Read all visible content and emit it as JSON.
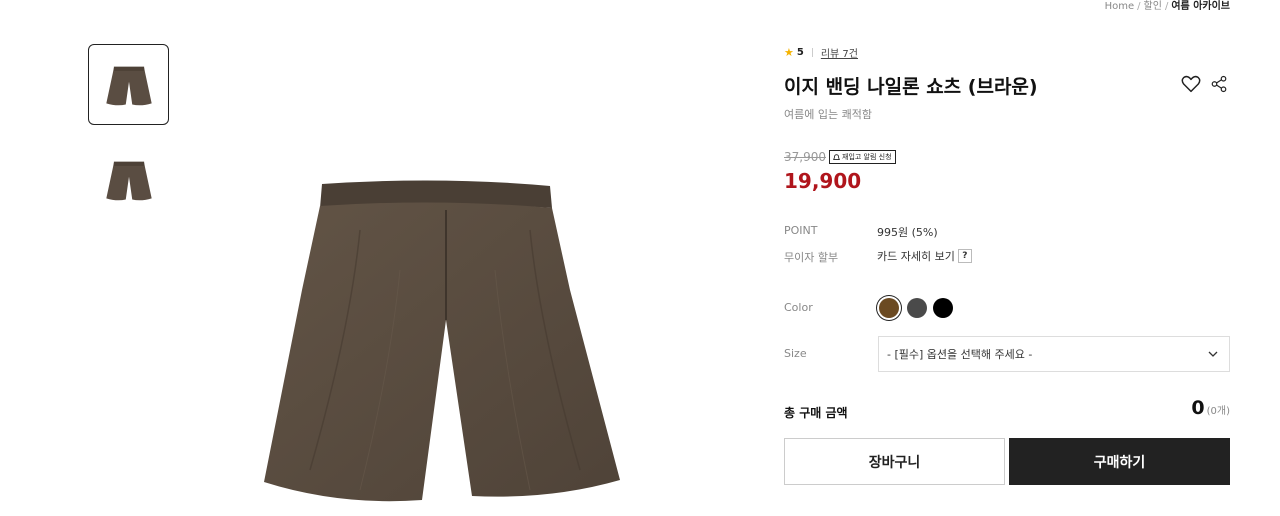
{
  "breadcrumb": {
    "items": [
      "Home",
      "할인",
      "여름 아카이브"
    ],
    "separator": "/"
  },
  "gallery": {
    "thumbnails": [
      {
        "icon": "shorts-thumbnail",
        "selected": true
      },
      {
        "icon": "shorts-thumbnail",
        "selected": false
      }
    ],
    "main_color": "#5a4d42"
  },
  "product": {
    "rating": "5",
    "review_link": "리뷰 7건",
    "title": "이지 밴딩 나일론 쇼츠 (브라운)",
    "subtitle": "여름에 입는 쾌적함",
    "original_price": "37,900",
    "restock_label": "재입고 알림 신청",
    "sale_price": "19,900",
    "sale_color": "#b0151c"
  },
  "details": {
    "point_label": "POINT",
    "point_value": "995원 (5%)",
    "installment_label": "무이자 할부",
    "installment_value": "카드 자세히 보기",
    "help_badge": "?"
  },
  "options": {
    "color_label": "Color",
    "colors": [
      {
        "name": "brown",
        "hex": "#6b4a22",
        "selected": true
      },
      {
        "name": "charcoal",
        "hex": "#4a4a4a",
        "selected": false
      },
      {
        "name": "black",
        "hex": "#000000",
        "selected": false
      }
    ],
    "size_label": "Size",
    "size_placeholder": "- [필수] 옵션을 선택해 주세요 -"
  },
  "total": {
    "label": "총 구매 금액",
    "value": "0",
    "count": "(0개)"
  },
  "actions": {
    "cart_label": "장바구니",
    "buy_label": "구매하기"
  }
}
